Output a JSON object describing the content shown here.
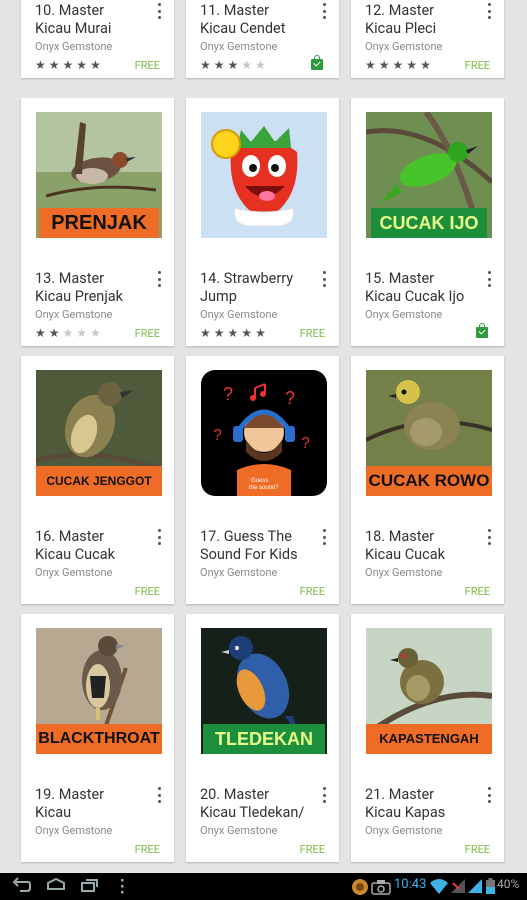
{
  "apps": [
    {
      "number": "10.",
      "name": "Master\nKicau Murai",
      "developer": "Onyx Gemstone",
      "rating": 5,
      "price": "FREE",
      "installed": false
    },
    {
      "number": "11.",
      "name": "Master\nKicau Cendet",
      "developer": "Onyx Gemstone",
      "rating": 3,
      "price": "",
      "installed": true
    },
    {
      "number": "12.",
      "name": "Master\nKicau Pleci",
      "developer": "Onyx Gemstone",
      "rating": 5,
      "price": "FREE",
      "installed": false
    },
    {
      "number": "13.",
      "name": "Master\nKicau Prenjak",
      "developer": "Onyx Gemstone",
      "rating": 2,
      "price": "FREE",
      "installed": false,
      "badge": "PRENJAK"
    },
    {
      "number": "14.",
      "name": "Strawberry\nJump",
      "developer": "Onyx Gemstone",
      "rating": 5,
      "price": "FREE",
      "installed": false
    },
    {
      "number": "15.",
      "name": "Master\nKicau Cucak Ijo",
      "developer": "Onyx Gemstone",
      "rating": 0,
      "price": "",
      "installed": true,
      "badge": "CUCAK IJO"
    },
    {
      "number": "16.",
      "name": "Master\nKicau Cucak",
      "developer": "Onyx Gemstone",
      "rating": 0,
      "price": "FREE",
      "installed": false,
      "badge": "CUCAK JENGGOT"
    },
    {
      "number": "17.",
      "name": "Guess The\nSound For Kids",
      "developer": "Onyx Gemstone",
      "rating": 0,
      "price": "FREE",
      "installed": false,
      "badge": "Guess\nthe sound?"
    },
    {
      "number": "18.",
      "name": "Master\nKicau Cucak",
      "developer": "Onyx Gemstone",
      "rating": 0,
      "price": "FREE",
      "installed": false,
      "badge": "CUCAK ROWO"
    },
    {
      "number": "19.",
      "name": "Master\nKicau",
      "developer": "Onyx Gemstone",
      "rating": 0,
      "price": "FREE",
      "installed": false,
      "badge": "BLACKTHROAT"
    },
    {
      "number": "20.",
      "name": "Master\nKicau Tledekan/",
      "developer": "Onyx Gemstone",
      "rating": 0,
      "price": "FREE",
      "installed": false,
      "badge": "TLEDEKAN"
    },
    {
      "number": "21.",
      "name": "Master\nKicau Kapas",
      "developer": "Onyx Gemstone",
      "rating": 0,
      "price": "FREE",
      "installed": false,
      "badge": "KAPASTENGAH"
    }
  ],
  "status_bar": {
    "time": "10:43",
    "battery": "40%"
  },
  "icons": {
    "back": "back-icon",
    "home": "home-icon",
    "recents": "recent-apps-icon",
    "menu": "overflow-menu-icon",
    "wifi": "wifi-icon",
    "signal": "signal-icon",
    "battery": "battery-icon",
    "camera": "screenshot-icon"
  }
}
